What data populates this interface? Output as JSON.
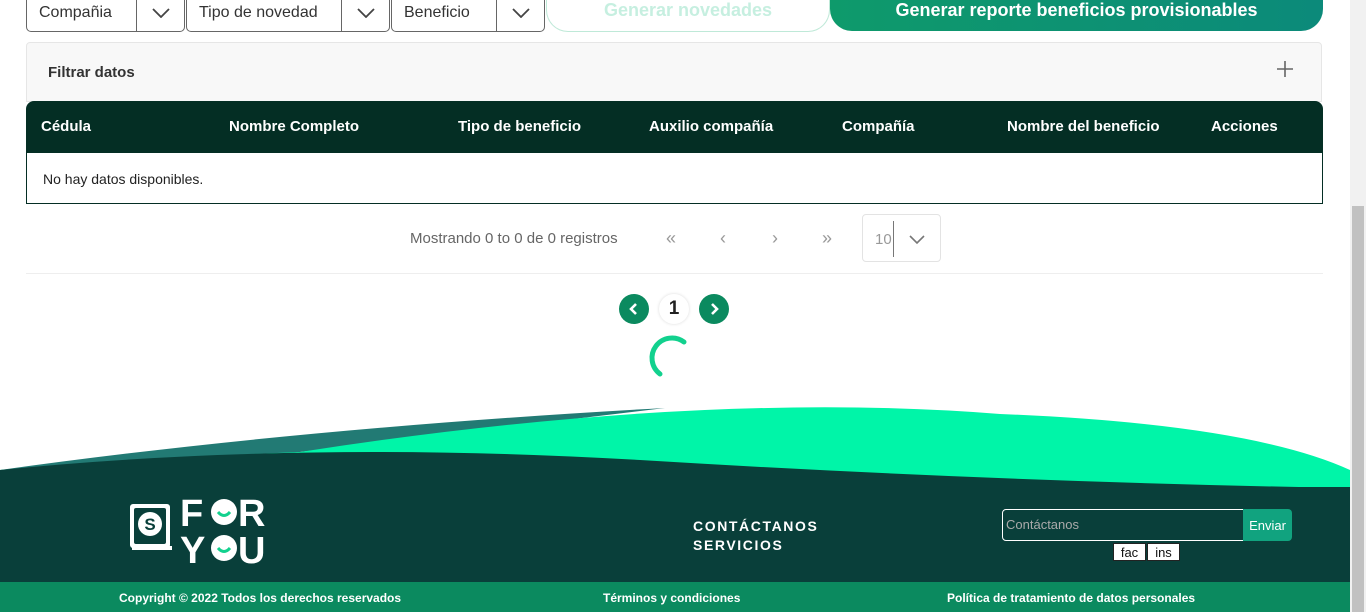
{
  "filters": {
    "company_label": "Compañia",
    "novelty_type_label": "Tipo de novedad",
    "benefit_label": "Beneficio"
  },
  "actions": {
    "generate_novelties": "Generar novedades",
    "generate_report": "Generar reporte beneficios provisionables"
  },
  "filter_panel": {
    "title": "Filtrar datos"
  },
  "table": {
    "columns": [
      "Cédula",
      "Nombre Completo",
      "Tipo de beneficio",
      "Auxilio compañía",
      "Compañía",
      "Nombre del beneficio",
      "Acciones"
    ],
    "empty_message": "No hay datos disponibles."
  },
  "pagination": {
    "info": "Mostrando 0 to 0 de 0 registros",
    "first": "«",
    "prev": "‹",
    "next": "›",
    "last": "»",
    "per_page": "10",
    "current_page": "1"
  },
  "footer": {
    "links": [
      "CONTÁCTANOS",
      "SERVICIOS"
    ],
    "contact_placeholder": "Contáctanos",
    "send_label": "Enviar",
    "social": [
      "fac",
      "ins"
    ],
    "copyright": "Copyright © 2022 Todos los derechos reservados",
    "terms": "Términos y condiciones",
    "privacy": "Política de tratamiento de datos personales"
  },
  "colors": {
    "primary_dark": "#042e24",
    "primary_green": "#0b8a5f",
    "accent_mint": "#00f5a8",
    "footer_bg": "#093f3a"
  }
}
